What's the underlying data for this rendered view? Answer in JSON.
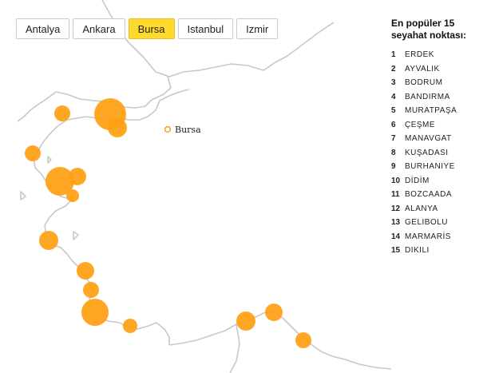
{
  "tabs": [
    {
      "label": "Antalya",
      "active": false
    },
    {
      "label": "Ankara",
      "active": false
    },
    {
      "label": "Bursa",
      "active": true
    },
    {
      "label": "Istanbul",
      "active": false
    },
    {
      "label": "Izmir",
      "active": false
    }
  ],
  "map": {
    "selected_city": "Bursa",
    "marker_color": "#ff9f12",
    "coast_color": "#c8c8c8"
  },
  "legend": {
    "title": "En popüler 15 seyahat noktası:",
    "items": [
      {
        "rank": "1",
        "name": "ERDEK"
      },
      {
        "rank": "2",
        "name": "AYVALIK"
      },
      {
        "rank": "3",
        "name": "BODRUM"
      },
      {
        "rank": "4",
        "name": "BANDIRMA"
      },
      {
        "rank": "5",
        "name": "MURATPAŞA"
      },
      {
        "rank": "6",
        "name": "ÇEŞME"
      },
      {
        "rank": "7",
        "name": "MANAVGAT"
      },
      {
        "rank": "8",
        "name": "KUŞADASI"
      },
      {
        "rank": "9",
        "name": "BURHANIYE"
      },
      {
        "rank": "10",
        "name": "DİDİM"
      },
      {
        "rank": "11",
        "name": "BOZCAADA"
      },
      {
        "rank": "12",
        "name": "ALANYA"
      },
      {
        "rank": "13",
        "name": "GELIBOLU"
      },
      {
        "rank": "14",
        "name": "MARMARİS"
      },
      {
        "rank": "15",
        "name": "DIKILI"
      }
    ]
  }
}
